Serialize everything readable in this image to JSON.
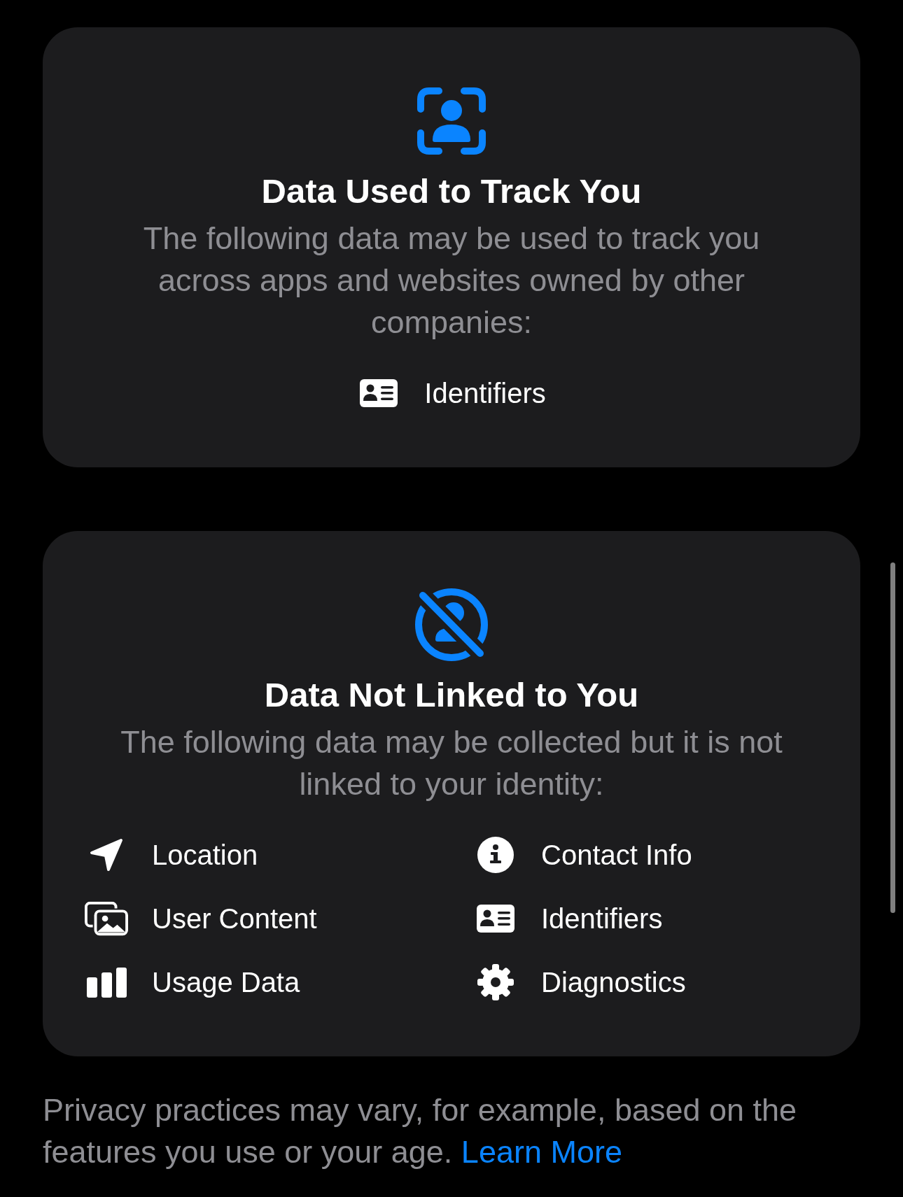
{
  "sections": [
    {
      "kind": "tracking",
      "title": "Data Used to Track You",
      "description": "The following data may be used to track you across apps and websites owned by other companies:",
      "items": [
        {
          "kind": "identifiers",
          "label": "Identifiers"
        }
      ]
    },
    {
      "kind": "unlinked",
      "title": "Data Not Linked to You",
      "description": "The following data may be collected but it is not linked to your identity:",
      "items": [
        {
          "kind": "location",
          "label": "Location"
        },
        {
          "kind": "contact",
          "label": "Contact Info"
        },
        {
          "kind": "content",
          "label": "User Content"
        },
        {
          "kind": "identifiers",
          "label": "Identifiers"
        },
        {
          "kind": "usage",
          "label": "Usage Data"
        },
        {
          "kind": "diagnostics",
          "label": "Diagnostics"
        }
      ]
    }
  ],
  "footer": {
    "text": "Privacy practices may vary, for example, based on the features you use or your age.",
    "link": "Learn More"
  }
}
